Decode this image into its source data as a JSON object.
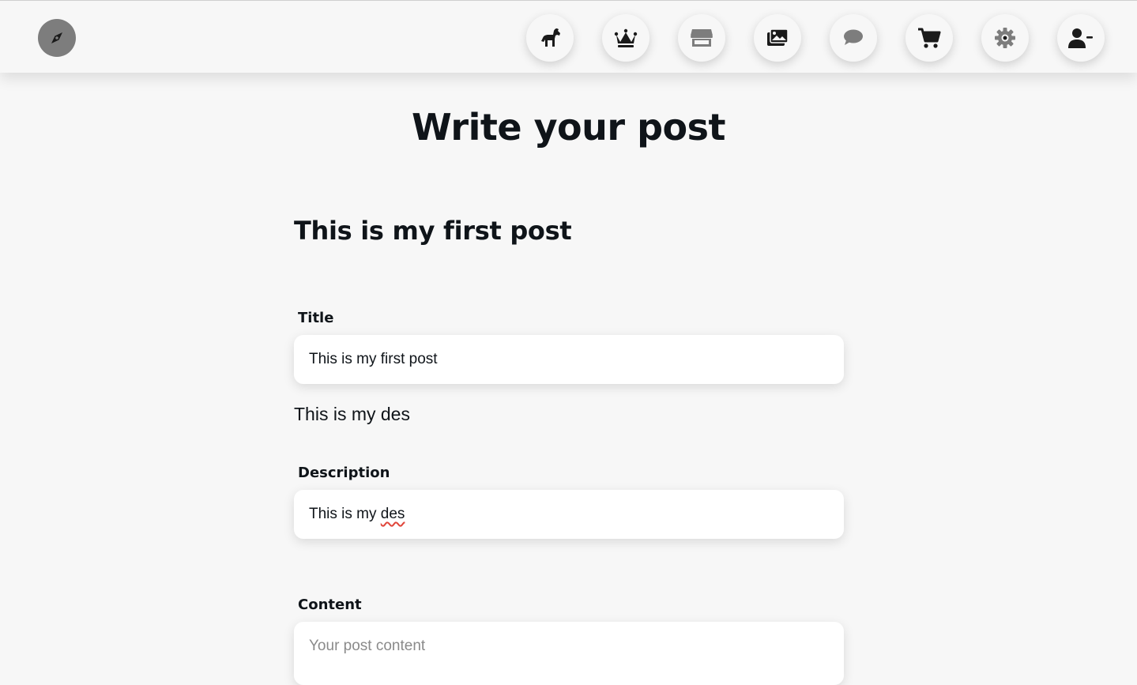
{
  "nav": {
    "logo_icon": "compass-icon",
    "buttons": [
      {
        "name": "horse-icon"
      },
      {
        "name": "crown-icon"
      },
      {
        "name": "store-icon"
      },
      {
        "name": "images-icon"
      },
      {
        "name": "chat-icon"
      },
      {
        "name": "cart-icon"
      },
      {
        "name": "gear-icon"
      },
      {
        "name": "user-minus-icon"
      }
    ]
  },
  "page": {
    "heading": "Write your post"
  },
  "preview": {
    "title": "This is my first post",
    "description": "This is my des"
  },
  "form": {
    "title_label": "Title",
    "title_value": "This is my first post",
    "description_label": "Description",
    "description_value_prefix": "This is my ",
    "description_value_misspelled": "des",
    "content_label": "Content",
    "content_placeholder": "Your post content"
  },
  "colors": {
    "background": "#f7f7f7",
    "text": "#0f1419",
    "logo_bg": "#7d7d7d",
    "spellcheck": "#e0463a"
  }
}
